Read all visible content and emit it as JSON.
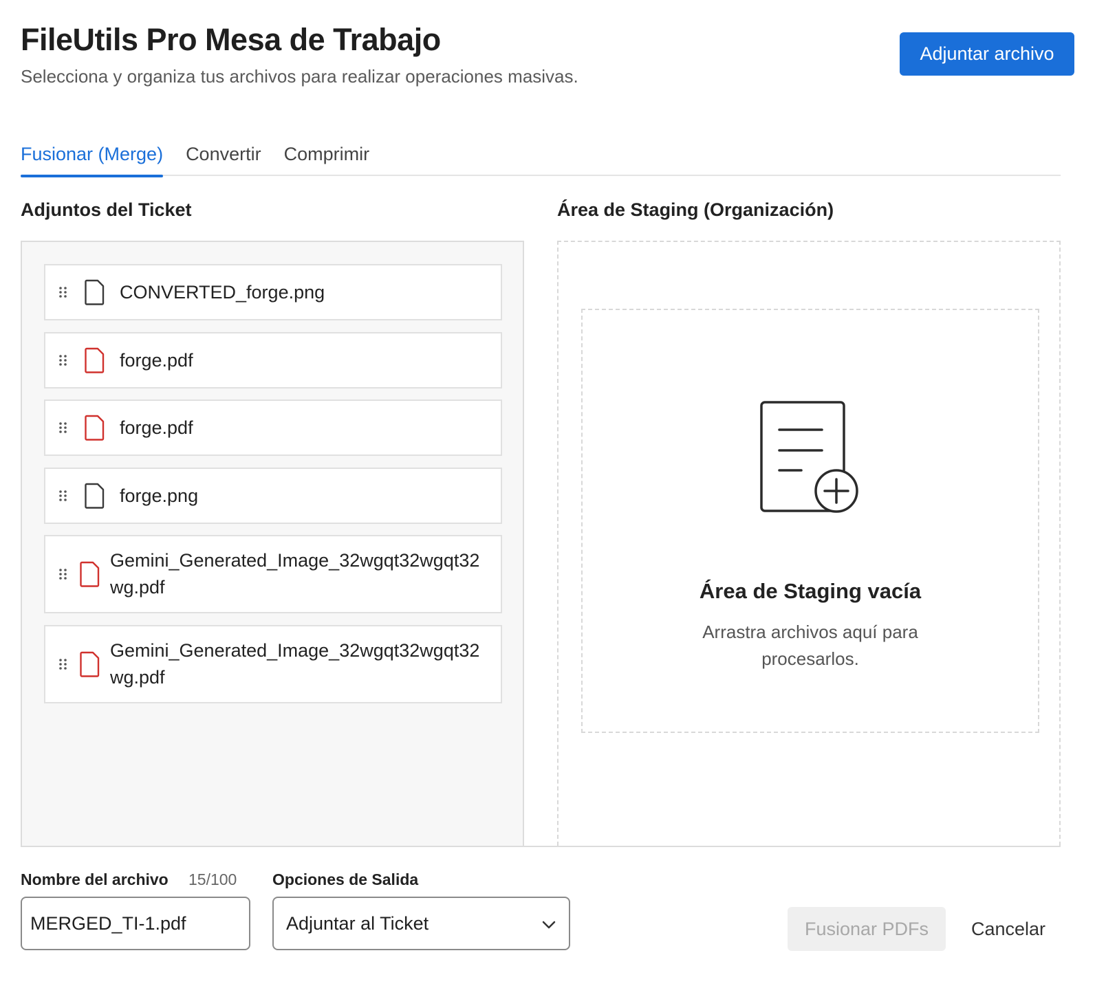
{
  "header": {
    "title": "FileUtils Pro Mesa de Trabajo",
    "subtitle": "Selecciona y organiza tus archivos para realizar operaciones masivas.",
    "attach_button": "Adjuntar archivo"
  },
  "tabs": [
    {
      "label": "Fusionar (Merge)",
      "active": true
    },
    {
      "label": "Convertir",
      "active": false
    },
    {
      "label": "Comprimir",
      "active": false
    }
  ],
  "attachments": {
    "title": "Adjuntos del Ticket",
    "files": [
      {
        "name": "CONVERTED_forge.png",
        "icon": "file-icon",
        "icon_color": "#3a3a3a"
      },
      {
        "name": "forge.pdf",
        "icon": "pdf-file-icon",
        "icon_color": "#d0312d"
      },
      {
        "name": "forge.pdf",
        "icon": "pdf-file-icon",
        "icon_color": "#d0312d"
      },
      {
        "name": "forge.png",
        "icon": "file-icon",
        "icon_color": "#3a3a3a"
      },
      {
        "name": "Gemini_Generated_Image_32wgqt32wgqt32wg.pdf",
        "icon": "pdf-file-icon",
        "icon_color": "#d0312d"
      },
      {
        "name": "Gemini_Generated_Image_32wgqt32wgqt32wg.pdf",
        "icon": "pdf-file-icon",
        "icon_color": "#d0312d"
      }
    ]
  },
  "staging": {
    "title": "Área de Staging (Organización)",
    "empty_heading": "Área de Staging vacía",
    "empty_text": "Arrastra archivos aquí para procesarlos.",
    "icon": "document-add-icon"
  },
  "footer": {
    "filename_label": "Nombre del archivo",
    "filename_counter": "15/100",
    "filename_value": "MERGED_TI-1.pdf",
    "output_label": "Opciones de Salida",
    "output_value": "Adjuntar al Ticket",
    "merge_button": "Fusionar PDFs",
    "merge_button_disabled": true,
    "cancel_button": "Cancelar"
  },
  "colors": {
    "accent": "#1a6fd9",
    "pdf": "#d0312d"
  }
}
